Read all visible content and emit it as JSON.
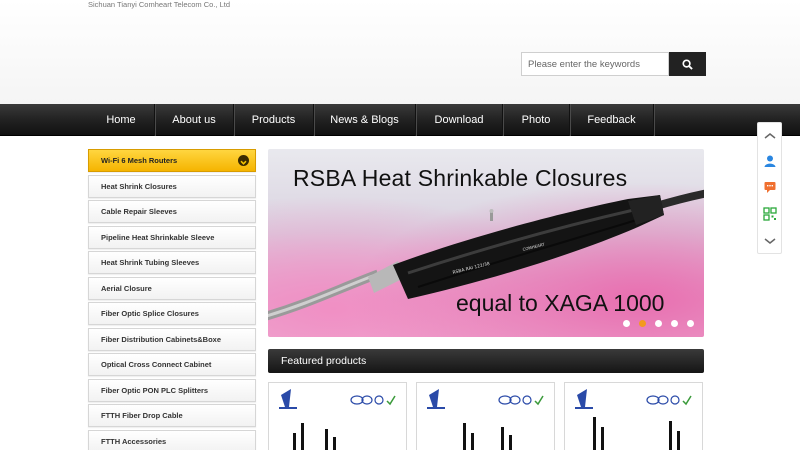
{
  "company": "Sichuan Tianyi Comheart Telecom Co., Ltd",
  "search": {
    "placeholder": "Please enter the keywords"
  },
  "nav": [
    "Home",
    "About us",
    "Products",
    "News & Blogs",
    "Download",
    "Photo",
    "Feedback"
  ],
  "sidebar": [
    "Wi-Fi 6 Mesh Routers",
    "Heat Shrink Closures",
    "Cable Repair Sleeves",
    "Pipeline Heat Shrinkable Sleeve",
    "Heat Shrink Tubing Sleeves",
    "Aerial Closure",
    "Fiber Optic Splice Closures",
    "Fiber Distribution Cabinets&Boxe",
    "Optical Cross Connect Cabinet",
    "Fiber Optic PON PLC Splitters",
    "FTTH Fiber Drop Cable",
    "FTTH Accessories"
  ],
  "banner": {
    "title": "RSBA Heat Shrinkable Closures",
    "subtitle": "equal to XAGA 1000",
    "active_slide": 2,
    "slide_count": 5
  },
  "featured": {
    "title": "Featured products"
  },
  "colors": {
    "accent": "#f5b400",
    "nav": "#222222",
    "dot_active": "#f39a1e"
  },
  "float_icons": [
    "chevron-up-icon",
    "user-icon",
    "chat-icon",
    "qr-code-icon",
    "chevron-down-icon"
  ]
}
